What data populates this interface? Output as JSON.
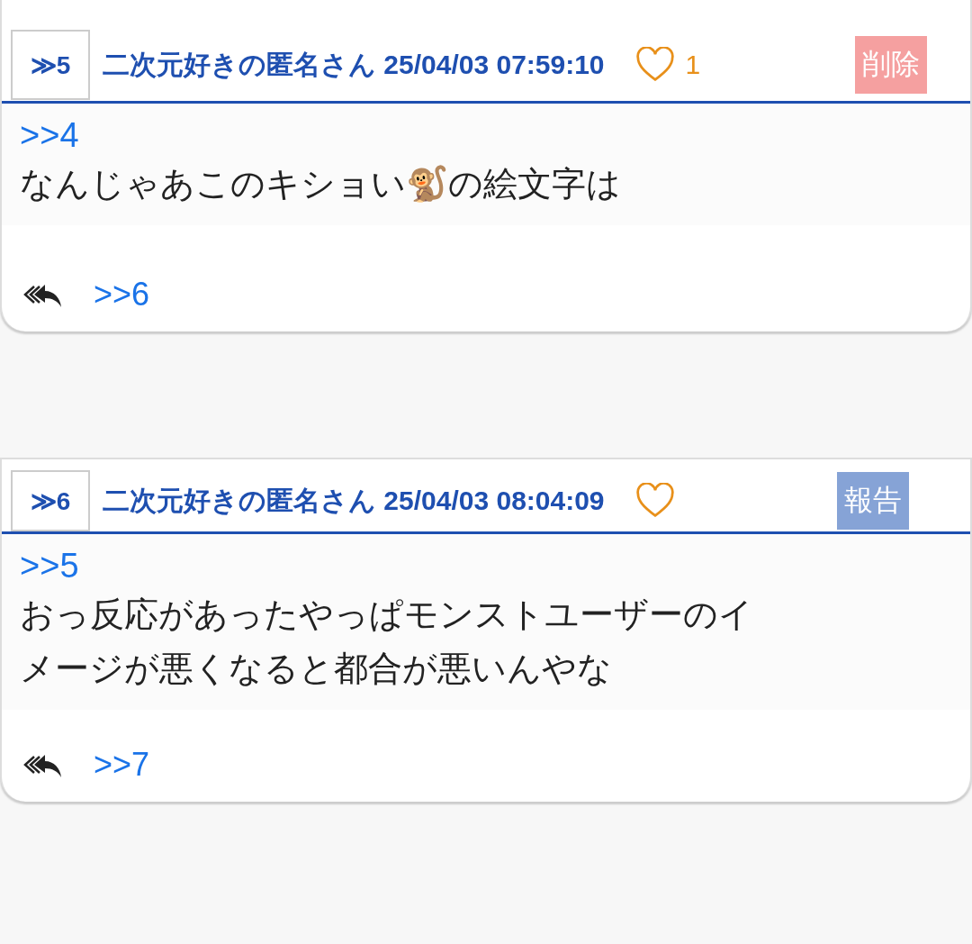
{
  "posts": [
    {
      "number": "≫5",
      "author": "二次元好きの匿名さん",
      "timestamp": "25/04/03 07:59:10",
      "likes": "1",
      "action": {
        "kind": "delete",
        "label": "削除"
      },
      "quote": ">>4",
      "body": [
        "なんじゃあこのキショい🐒の絵文字は"
      ],
      "reply": ">>6"
    },
    {
      "number": "≫6",
      "author": "二次元好きの匿名さん",
      "timestamp": "25/04/03 08:04:09",
      "action": {
        "kind": "report",
        "label": "報告"
      },
      "quote": ">>5",
      "body": [
        "おっ反応があったやっぱモンストユーザーのイ",
        "メージが悪くなると都合が悪いんやな"
      ],
      "reply": ">>7"
    }
  ]
}
